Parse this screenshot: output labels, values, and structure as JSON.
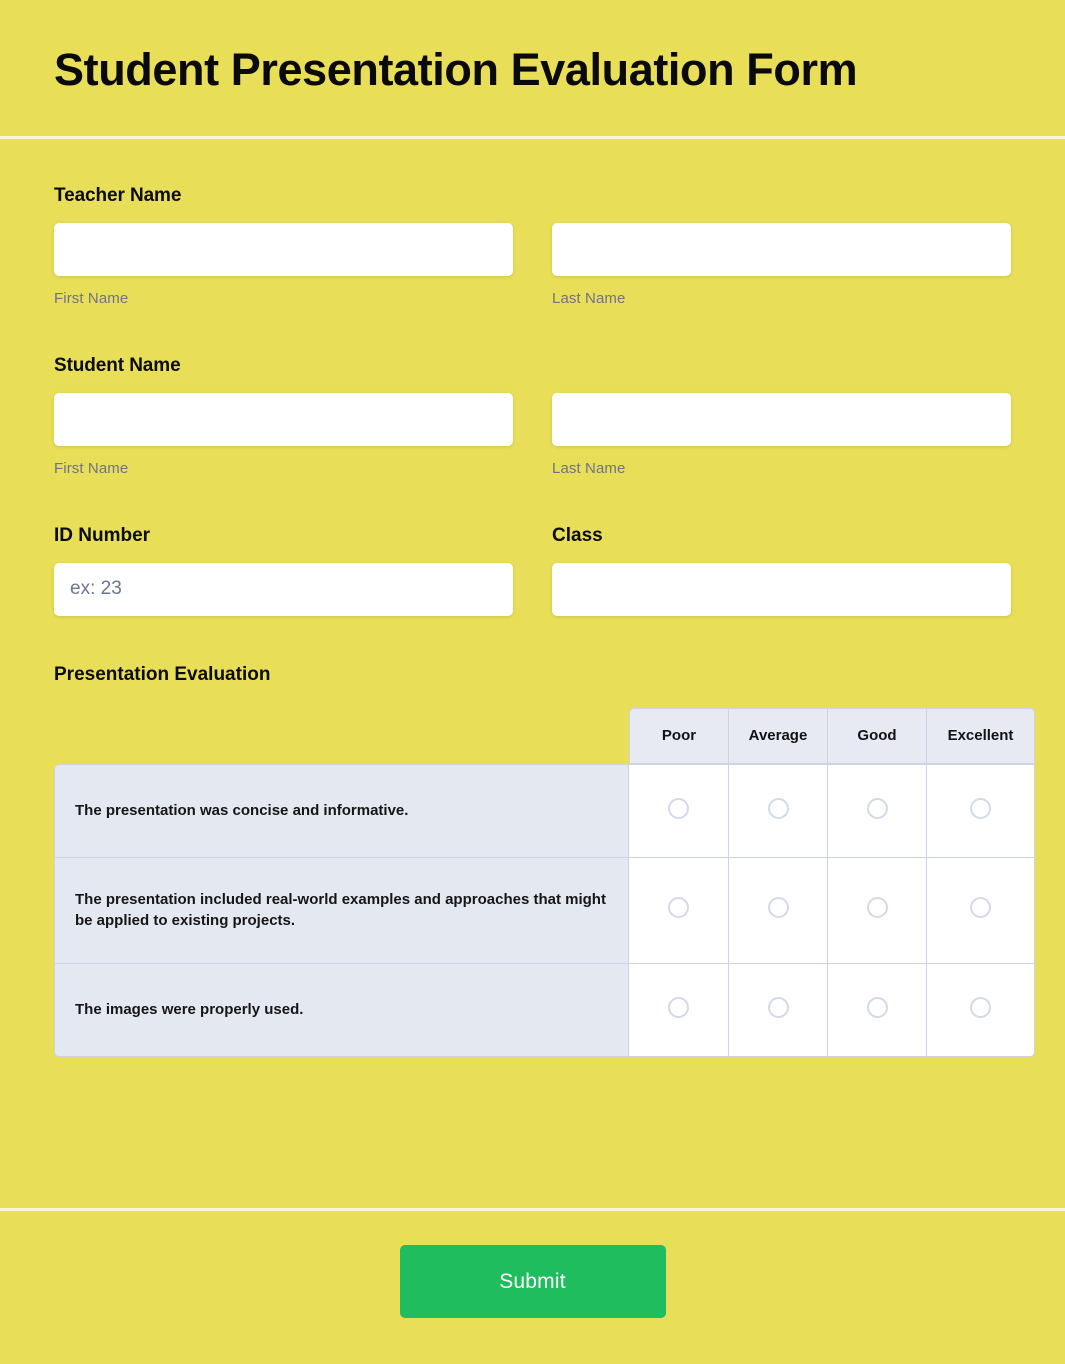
{
  "header": {
    "title": "Student Presentation Evaluation Form"
  },
  "fields": {
    "teacher_name": {
      "label": "Teacher Name",
      "first": {
        "value": "",
        "placeholder": "",
        "sub_label": "First Name"
      },
      "last": {
        "value": "",
        "placeholder": "",
        "sub_label": "Last Name"
      }
    },
    "student_name": {
      "label": "Student Name",
      "first": {
        "value": "",
        "placeholder": "",
        "sub_label": "First Name"
      },
      "last": {
        "value": "",
        "placeholder": "",
        "sub_label": "Last Name"
      }
    },
    "id_number": {
      "label": "ID Number",
      "value": "",
      "placeholder": "ex: 23"
    },
    "class": {
      "label": "Class",
      "value": "",
      "placeholder": ""
    }
  },
  "evaluation": {
    "label": "Presentation Evaluation",
    "columns": [
      "Poor",
      "Average",
      "Good",
      "Excellent"
    ],
    "rows": [
      {
        "statement": "The presentation was concise and informative.",
        "selected": null
      },
      {
        "statement": "The presentation included real-world examples and approaches that might be applied to existing projects.",
        "selected": null
      },
      {
        "statement": "The images were properly used.",
        "selected": null
      }
    ]
  },
  "footer": {
    "submit_label": "Submit"
  },
  "colors": {
    "background": "#e9de58",
    "divider": "#fbf6d2",
    "submit": "#1fbd5d",
    "statement_cell": "#e4e8f1",
    "header_cell": "#e7eaf3",
    "cell_border": "#ccd3e4",
    "sub_label": "#6f7385",
    "placeholder": "#6d7590",
    "title": "#0a0a0a"
  }
}
